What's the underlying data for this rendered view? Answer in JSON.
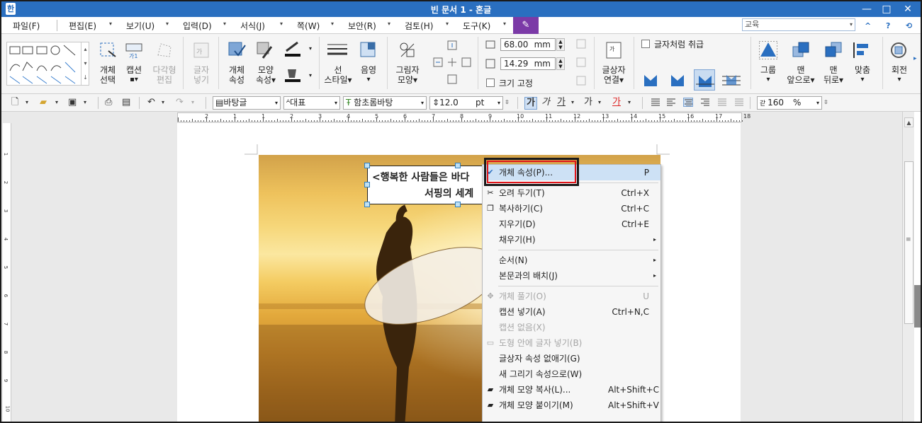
{
  "window": {
    "title": "빈 문서 1 - 혼글",
    "min": "—",
    "max": "□",
    "close": "✕"
  },
  "menu": {
    "items": [
      "파일(F)",
      "편집(E)",
      "보기(U)",
      "입력(D)",
      "서식(J)",
      "쪽(W)",
      "보안(R)",
      "검토(H)",
      "도구(K)"
    ],
    "search_value": "교육",
    "help": "?",
    "collapse": "^"
  },
  "ribbon": {
    "obj_select": [
      "개체",
      "선택"
    ],
    "caption": [
      "캡션"
    ],
    "polygon_edit": [
      "다각형",
      "편집"
    ],
    "insert_text": [
      "글자",
      "넣기"
    ],
    "obj_props": [
      "개체",
      "속성"
    ],
    "shape_props": [
      "모양",
      "속성▾"
    ],
    "line_style": [
      "선",
      "스타일▾"
    ],
    "shadow": [
      "음영"
    ],
    "picture_shape": [
      "그림자",
      "모양▾"
    ],
    "width_value": "68.00",
    "height_value": "14.29",
    "unit": "mm",
    "fixed_size": "크기 고정",
    "treat_as_char": "글자처럼 취급",
    "link_text": [
      "글상자",
      "연결▾"
    ],
    "group": [
      "그룹"
    ],
    "bring_front": [
      "맨",
      "앞으로▾"
    ],
    "send_back": [
      "맨",
      "뒤로▾"
    ],
    "align": [
      "맞춤"
    ],
    "rotate": [
      "회전"
    ]
  },
  "toolbar2": {
    "style": "바탕글",
    "para": "대표",
    "font": "함초롬바탕",
    "size": "12.0",
    "size_unit": "pt",
    "zoom": "160",
    "zoom_unit": "%",
    "bold": "가",
    "italic": "가",
    "underline": "가",
    "strike": "가",
    "fontcolor": "가"
  },
  "ruler": {
    "labels": [
      "2",
      "1",
      "1",
      "2",
      "3",
      "4",
      "5",
      "6",
      "7",
      "8",
      "9",
      "10",
      "11",
      "12",
      "13",
      "14",
      "15",
      "16",
      "17",
      "18"
    ]
  },
  "vruler": {
    "labels": [
      "1",
      "2",
      "3",
      "4",
      "5",
      "6",
      "7",
      "8",
      "9",
      "10"
    ]
  },
  "document": {
    "textbox_line1": "<행복한 사람들은 바다",
    "textbox_line2": "서핑의 세계"
  },
  "context_menu": {
    "items": [
      {
        "label": "개체 속성(P)...",
        "shortcut": "P"
      },
      {
        "label": "오려 두기(T)",
        "shortcut": "Ctrl+X"
      },
      {
        "label": "복사하기(C)",
        "shortcut": "Ctrl+C"
      },
      {
        "label": "지우기(D)",
        "shortcut": "Ctrl+E"
      },
      {
        "label": "채우기(H)",
        "shortcut": ""
      },
      {
        "label": "순서(N)",
        "shortcut": ""
      },
      {
        "label": "본문과의 배치(J)",
        "shortcut": ""
      },
      {
        "label": "개체 풀기(O)",
        "shortcut": "U"
      },
      {
        "label": "캡션 넣기(A)",
        "shortcut": "Ctrl+N,C"
      },
      {
        "label": "캡션 없음(X)",
        "shortcut": ""
      },
      {
        "label": "도형 안에 글자 넣기(B)",
        "shortcut": ""
      },
      {
        "label": "글상자 속성 없애기(G)",
        "shortcut": ""
      },
      {
        "label": "새 그리기 속성으로(W)",
        "shortcut": ""
      },
      {
        "label": "개체 모양 복사(L)...",
        "shortcut": "Alt+Shift+C"
      },
      {
        "label": "개체 모양 붙이기(M)",
        "shortcut": "Alt+Shift+V"
      }
    ]
  },
  "colors": {
    "titlebar": "#2a6fc0",
    "highlight": "#e0151b",
    "tool_btn": "#7b3aa7"
  }
}
